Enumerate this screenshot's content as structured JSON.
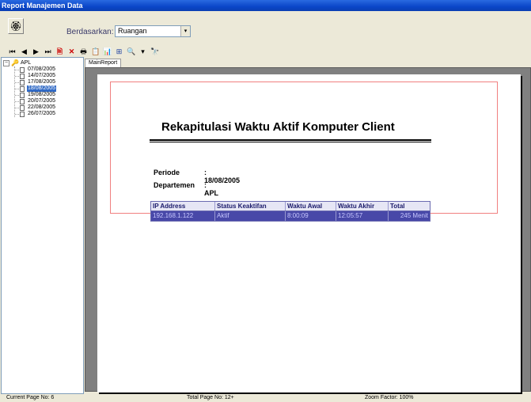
{
  "window": {
    "title": "Report Manajemen Data"
  },
  "filter": {
    "label": "Berdasarkan:",
    "selected": "Ruangan",
    "arrow": "▾"
  },
  "app_icon": "🏵",
  "toolbar": {
    "first": "⏮",
    "prev": "◀",
    "next": "▶",
    "last": "⏭",
    "export": "🖹",
    "close": "✕",
    "print": "🖶",
    "copy": "📋",
    "chart": "📊",
    "tree": "⊞",
    "zoom": "🔍",
    "zoom_dropdown": "▾",
    "find": "🔭"
  },
  "tree": {
    "root_expander": "−",
    "root_label": "APL",
    "root_icon": "🔑",
    "items": [
      {
        "label": "07/08/2005",
        "selected": false
      },
      {
        "label": "14/07/2005",
        "selected": false
      },
      {
        "label": "17/08/2005",
        "selected": false
      },
      {
        "label": "18/08/2005",
        "selected": true
      },
      {
        "label": "19/08/2005",
        "selected": false
      },
      {
        "label": "20/07/2005",
        "selected": false
      },
      {
        "label": "22/08/2005",
        "selected": false
      },
      {
        "label": "26/07/2005",
        "selected": false
      }
    ]
  },
  "tabs": {
    "main": "MainReport"
  },
  "report": {
    "title": "Rekapitulasi Waktu Aktif Komputer Client",
    "periode_label": "Periode",
    "periode_value": ": 18/08/2005",
    "departemen_label": "Departemen",
    "departemen_value": ": APL",
    "table": {
      "headers": [
        "IP Address",
        "Status Keaktifan",
        "Waktu Awal",
        "Waktu Akhir",
        "Total"
      ],
      "rows": [
        [
          "192.168.1.122",
          "Aktif",
          "8:00:09",
          "12:05:57",
          "245 Menit"
        ]
      ]
    }
  },
  "status": {
    "current_page": "Current Page No: 6",
    "total_page": "Total Page No: 12+",
    "zoom": "Zoom Factor: 100%"
  }
}
